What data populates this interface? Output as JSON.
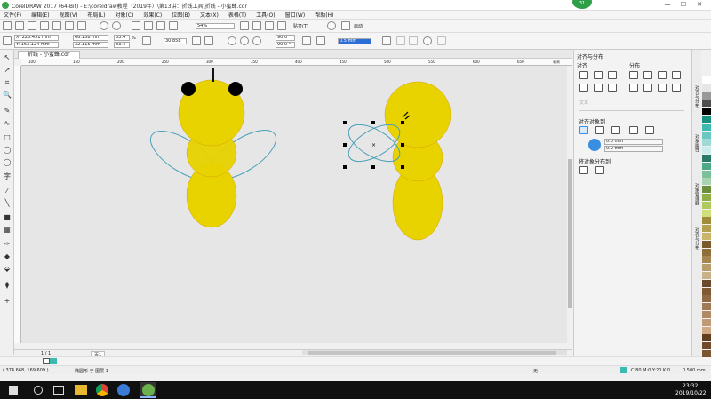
{
  "window": {
    "title": "CorelDRAW 2017 (64-Bit) - E:\\coreldraw教程（2019年）\\第13讲：折线工具\\折线 - 小蜜蜂.cdr",
    "badge": "31",
    "minimize": "—",
    "maximize": "☐",
    "close": "✕"
  },
  "menu": [
    "文件(F)",
    "编辑(E)",
    "视图(V)",
    "布局(L)",
    "对象(C)",
    "效果(C)",
    "位图(B)",
    "文本(X)",
    "表格(T)",
    "工具(O)",
    "窗口(W)",
    "帮助(H)"
  ],
  "toolbar1": {
    "zoom": "54%",
    "snap": "贴齐(T)",
    "launch": "启动"
  },
  "propbar": {
    "x": "X: 225.451 mm",
    "y": "Y: 163.124 mm",
    "w": "66.158 mm",
    "h": "32.115 mm",
    "sx": "83.4",
    "sy": "83.4",
    "pct": "%",
    "angle": "30.858",
    "deg1": "90.0 °",
    "deg2": "90.0 °",
    "outline": "0.5 mm"
  },
  "tools": [
    "↖",
    "↗",
    "⌗",
    "🔍",
    "✎",
    "∿",
    "□",
    "◯",
    "◯",
    "字",
    "⁄",
    "╲",
    "■",
    "▦",
    "✑",
    "◆",
    "⬙",
    "⧫",
    "+"
  ],
  "doctab": {
    "label": "折线 - 小蜜蜂.cdr"
  },
  "ruler": {
    "ticks": [
      "100",
      "150",
      "200",
      "250",
      "300",
      "350",
      "400",
      "450",
      "500",
      "550",
      "600",
      "650"
    ],
    "unit": "毫米"
  },
  "pagebar": {
    "pages": "1 / 1",
    "page_label": "页1"
  },
  "statusbar": {
    "coords": "( 374.668, 169.609 )",
    "info": "椭圆形 于 图层 1",
    "fill_none": "无",
    "color_info": "C:80 M:0 Y:20 K:0",
    "outline_info": "0.500 mm"
  },
  "docker": {
    "title": "对齐与分布",
    "align": "对齐",
    "distribute": "分布",
    "text_label": "文本",
    "align_to": "对齐对象到",
    "distribute_to": "将对象分布到",
    "v1": "0.0 mm",
    "v2": "0.0 mm",
    "tabs": [
      "对齐与分布",
      "对象属性",
      "对象管理器",
      "对齐与分布"
    ]
  },
  "taskbar": {
    "time": "23:32",
    "date": "2019/10/22"
  },
  "colors": {
    "body": "#e8d200",
    "body_stroke": "#d4a200",
    "wing": "#4aa0b8",
    "eye": "#000000",
    "accent": "#3a8ee0"
  },
  "palette": [
    "#ffffff",
    "#e6e6e6",
    "#999999",
    "#4d4d4d",
    "#000000",
    "#1a9080",
    "#3dbab0",
    "#69c9c0",
    "#9fdad6",
    "#c8ece9",
    "#2a7a6a",
    "#4fa886",
    "#7dbf9a",
    "#a9d4b2",
    "#6b8f3a",
    "#8fae48",
    "#b0c95c",
    "#cfe07a",
    "#a08c3a",
    "#b5a050",
    "#c9b56b",
    "#7a5a2a",
    "#8f6e3a",
    "#a58550",
    "#b89c6a",
    "#c9b288",
    "#6a4a2a",
    "#805a34",
    "#906a44",
    "#a07a54",
    "#b08a64",
    "#c09a74",
    "#d0aa84",
    "#604020",
    "#704a28",
    "#7a5530"
  ]
}
